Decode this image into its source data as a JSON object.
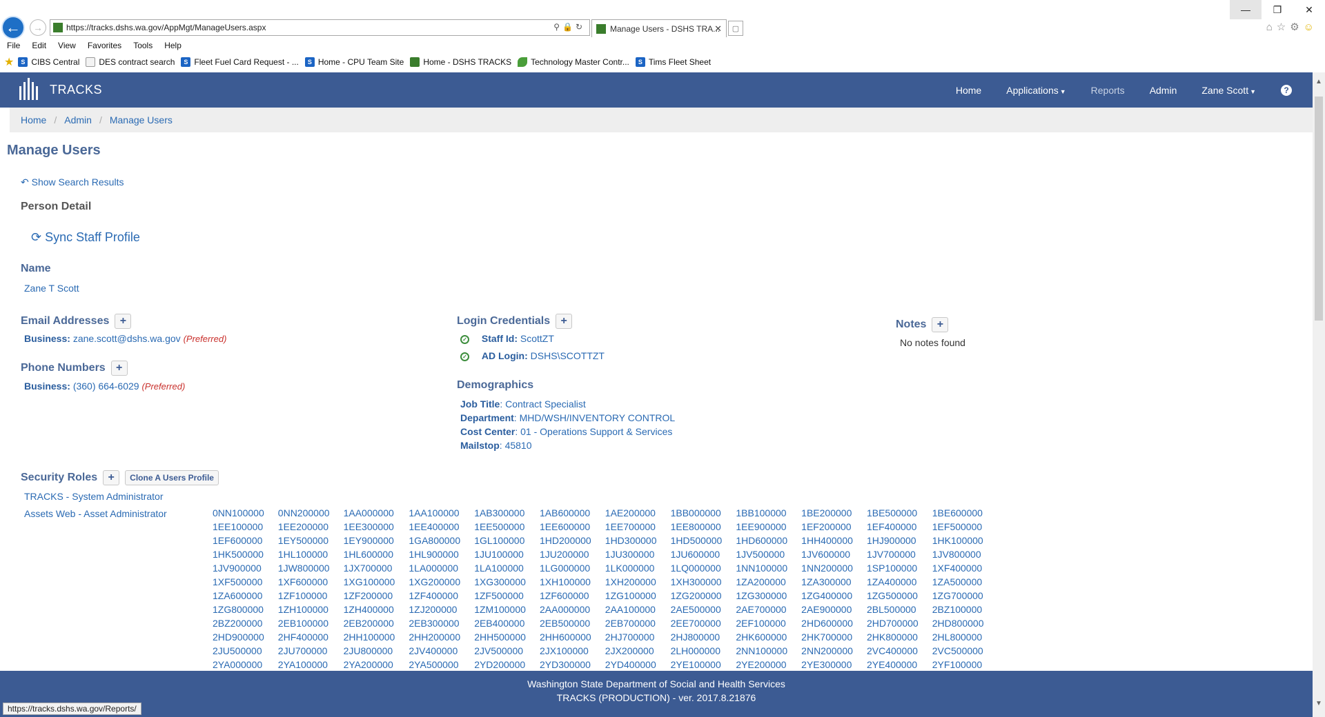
{
  "browser": {
    "url": "https://tracks.dshs.wa.gov/AppMgt/ManageUsers.aspx",
    "tab_title": "Manage Users - DSHS TRA...",
    "menu": [
      "File",
      "Edit",
      "View",
      "Favorites",
      "Tools",
      "Help"
    ],
    "favorites": [
      {
        "label": "CIBS Central",
        "icon": "sharepoint-icon"
      },
      {
        "label": "DES contract search",
        "icon": "page-icon"
      },
      {
        "label": "Fleet Fuel Card Request - ...",
        "icon": "sharepoint-icon"
      },
      {
        "label": "Home - CPU Team Site",
        "icon": "sharepoint-icon"
      },
      {
        "label": "Home - DSHS TRACKS",
        "icon": "tracks-icon"
      },
      {
        "label": "Technology Master Contr...",
        "icon": "leaf-icon"
      },
      {
        "label": "Tims Fleet Sheet",
        "icon": "sharepoint-icon"
      }
    ],
    "status_url": "https://tracks.dshs.wa.gov/Reports/"
  },
  "app": {
    "brand": "TRACKS",
    "nav": {
      "home": "Home",
      "applications": "Applications",
      "reports": "Reports",
      "admin": "Admin",
      "user": "Zane Scott"
    },
    "breadcrumb": [
      "Home",
      "Admin",
      "Manage Users"
    ]
  },
  "page": {
    "title": "Manage Users",
    "show_search_results": "Show Search Results",
    "person_detail": "Person Detail",
    "sync_staff_profile": "Sync Staff Profile",
    "name_heading": "Name",
    "name_value": "Zane T Scott",
    "email": {
      "heading": "Email Addresses",
      "label": "Business:",
      "value": "zane.scott@dshs.wa.gov",
      "preferred": "(Preferred)"
    },
    "phone": {
      "heading": "Phone Numbers",
      "label": "Business:",
      "value": "(360) 664-6029",
      "preferred": "(Preferred)"
    },
    "login": {
      "heading": "Login Credentials",
      "staff_id_label": "Staff Id:",
      "staff_id": "ScottZT",
      "ad_login_label": "AD Login:",
      "ad_login": "DSHS\\SCOTTZT"
    },
    "demographics": {
      "heading": "Demographics",
      "job_title_label": "Job Title",
      "job_title": "Contract Specialist",
      "department_label": "Department",
      "department": "MHD/WSH/INVENTORY CONTROL",
      "cost_center_label": "Cost Center",
      "cost_center": "01 - Operations Support & Services",
      "mailstop_label": "Mailstop",
      "mailstop": "45810"
    },
    "notes": {
      "heading": "Notes",
      "empty": "No notes found"
    },
    "security": {
      "heading": "Security Roles",
      "clone_button": "Clone A Users Profile",
      "roles": [
        "TRACKS - System Administrator",
        "Assets Web - Asset Administrator"
      ],
      "codes": [
        "0NN100000",
        "0NN200000",
        "1AA000000",
        "1AA100000",
        "1AB300000",
        "1AB600000",
        "1AE200000",
        "1BB000000",
        "1BB100000",
        "1BE200000",
        "1BE500000",
        "1BE600000",
        "1EE100000",
        "1EE200000",
        "1EE300000",
        "1EE400000",
        "1EE500000",
        "1EE600000",
        "1EE700000",
        "1EE800000",
        "1EE900000",
        "1EF200000",
        "1EF400000",
        "1EF500000",
        "1EF600000",
        "1EY500000",
        "1EY900000",
        "1GA800000",
        "1GL100000",
        "1HD200000",
        "1HD300000",
        "1HD500000",
        "1HD600000",
        "1HH400000",
        "1HJ900000",
        "1HK100000",
        "1HK500000",
        "1HL100000",
        "1HL600000",
        "1HL900000",
        "1JU100000",
        "1JU200000",
        "1JU300000",
        "1JU600000",
        "1JV500000",
        "1JV600000",
        "1JV700000",
        "1JV800000",
        "1JV900000",
        "1JW800000",
        "1JX700000",
        "1LA000000",
        "1LA100000",
        "1LG000000",
        "1LK000000",
        "1LQ000000",
        "1NN100000",
        "1NN200000",
        "1SP100000",
        "1XF400000",
        "1XF500000",
        "1XF600000",
        "1XG100000",
        "1XG200000",
        "1XG300000",
        "1XH100000",
        "1XH200000",
        "1XH300000",
        "1ZA200000",
        "1ZA300000",
        "1ZA400000",
        "1ZA500000",
        "1ZA600000",
        "1ZF100000",
        "1ZF200000",
        "1ZF400000",
        "1ZF500000",
        "1ZF600000",
        "1ZG100000",
        "1ZG200000",
        "1ZG300000",
        "1ZG400000",
        "1ZG500000",
        "1ZG700000",
        "1ZG800000",
        "1ZH100000",
        "1ZH400000",
        "1ZJ200000",
        "1ZM100000",
        "2AA000000",
        "2AA100000",
        "2AE500000",
        "2AE700000",
        "2AE900000",
        "2BL500000",
        "2BZ100000",
        "2BZ200000",
        "2EB100000",
        "2EB200000",
        "2EB300000",
        "2EB400000",
        "2EB500000",
        "2EB700000",
        "2EE700000",
        "2EF100000",
        "2HD600000",
        "2HD700000",
        "2HD800000",
        "2HD900000",
        "2HF400000",
        "2HH100000",
        "2HH200000",
        "2HH500000",
        "2HH600000",
        "2HJ700000",
        "2HJ800000",
        "2HK600000",
        "2HK700000",
        "2HK800000",
        "2HL800000",
        "2JU500000",
        "2JU700000",
        "2JU800000",
        "2JV400000",
        "2JV500000",
        "2JX100000",
        "2JX200000",
        "2LH000000",
        "2NN100000",
        "2NN200000",
        "2VC400000",
        "2VC500000",
        "2YA000000",
        "2YA100000",
        "2YA200000",
        "2YA500000",
        "2YD200000",
        "2YD300000",
        "2YD400000",
        "2YE100000",
        "2YE200000",
        "2YE300000",
        "2YE400000",
        "2YF100000"
      ]
    }
  },
  "footer": {
    "line1": "Washington State Department of Social and Health Services",
    "line2": "TRACKS (PRODUCTION) - ver. 2017.8.21876"
  },
  "colors": {
    "navbar": "#3c5b93",
    "link": "#2a6ab3",
    "heading": "#4a6897",
    "preferred": "#c9302c"
  }
}
